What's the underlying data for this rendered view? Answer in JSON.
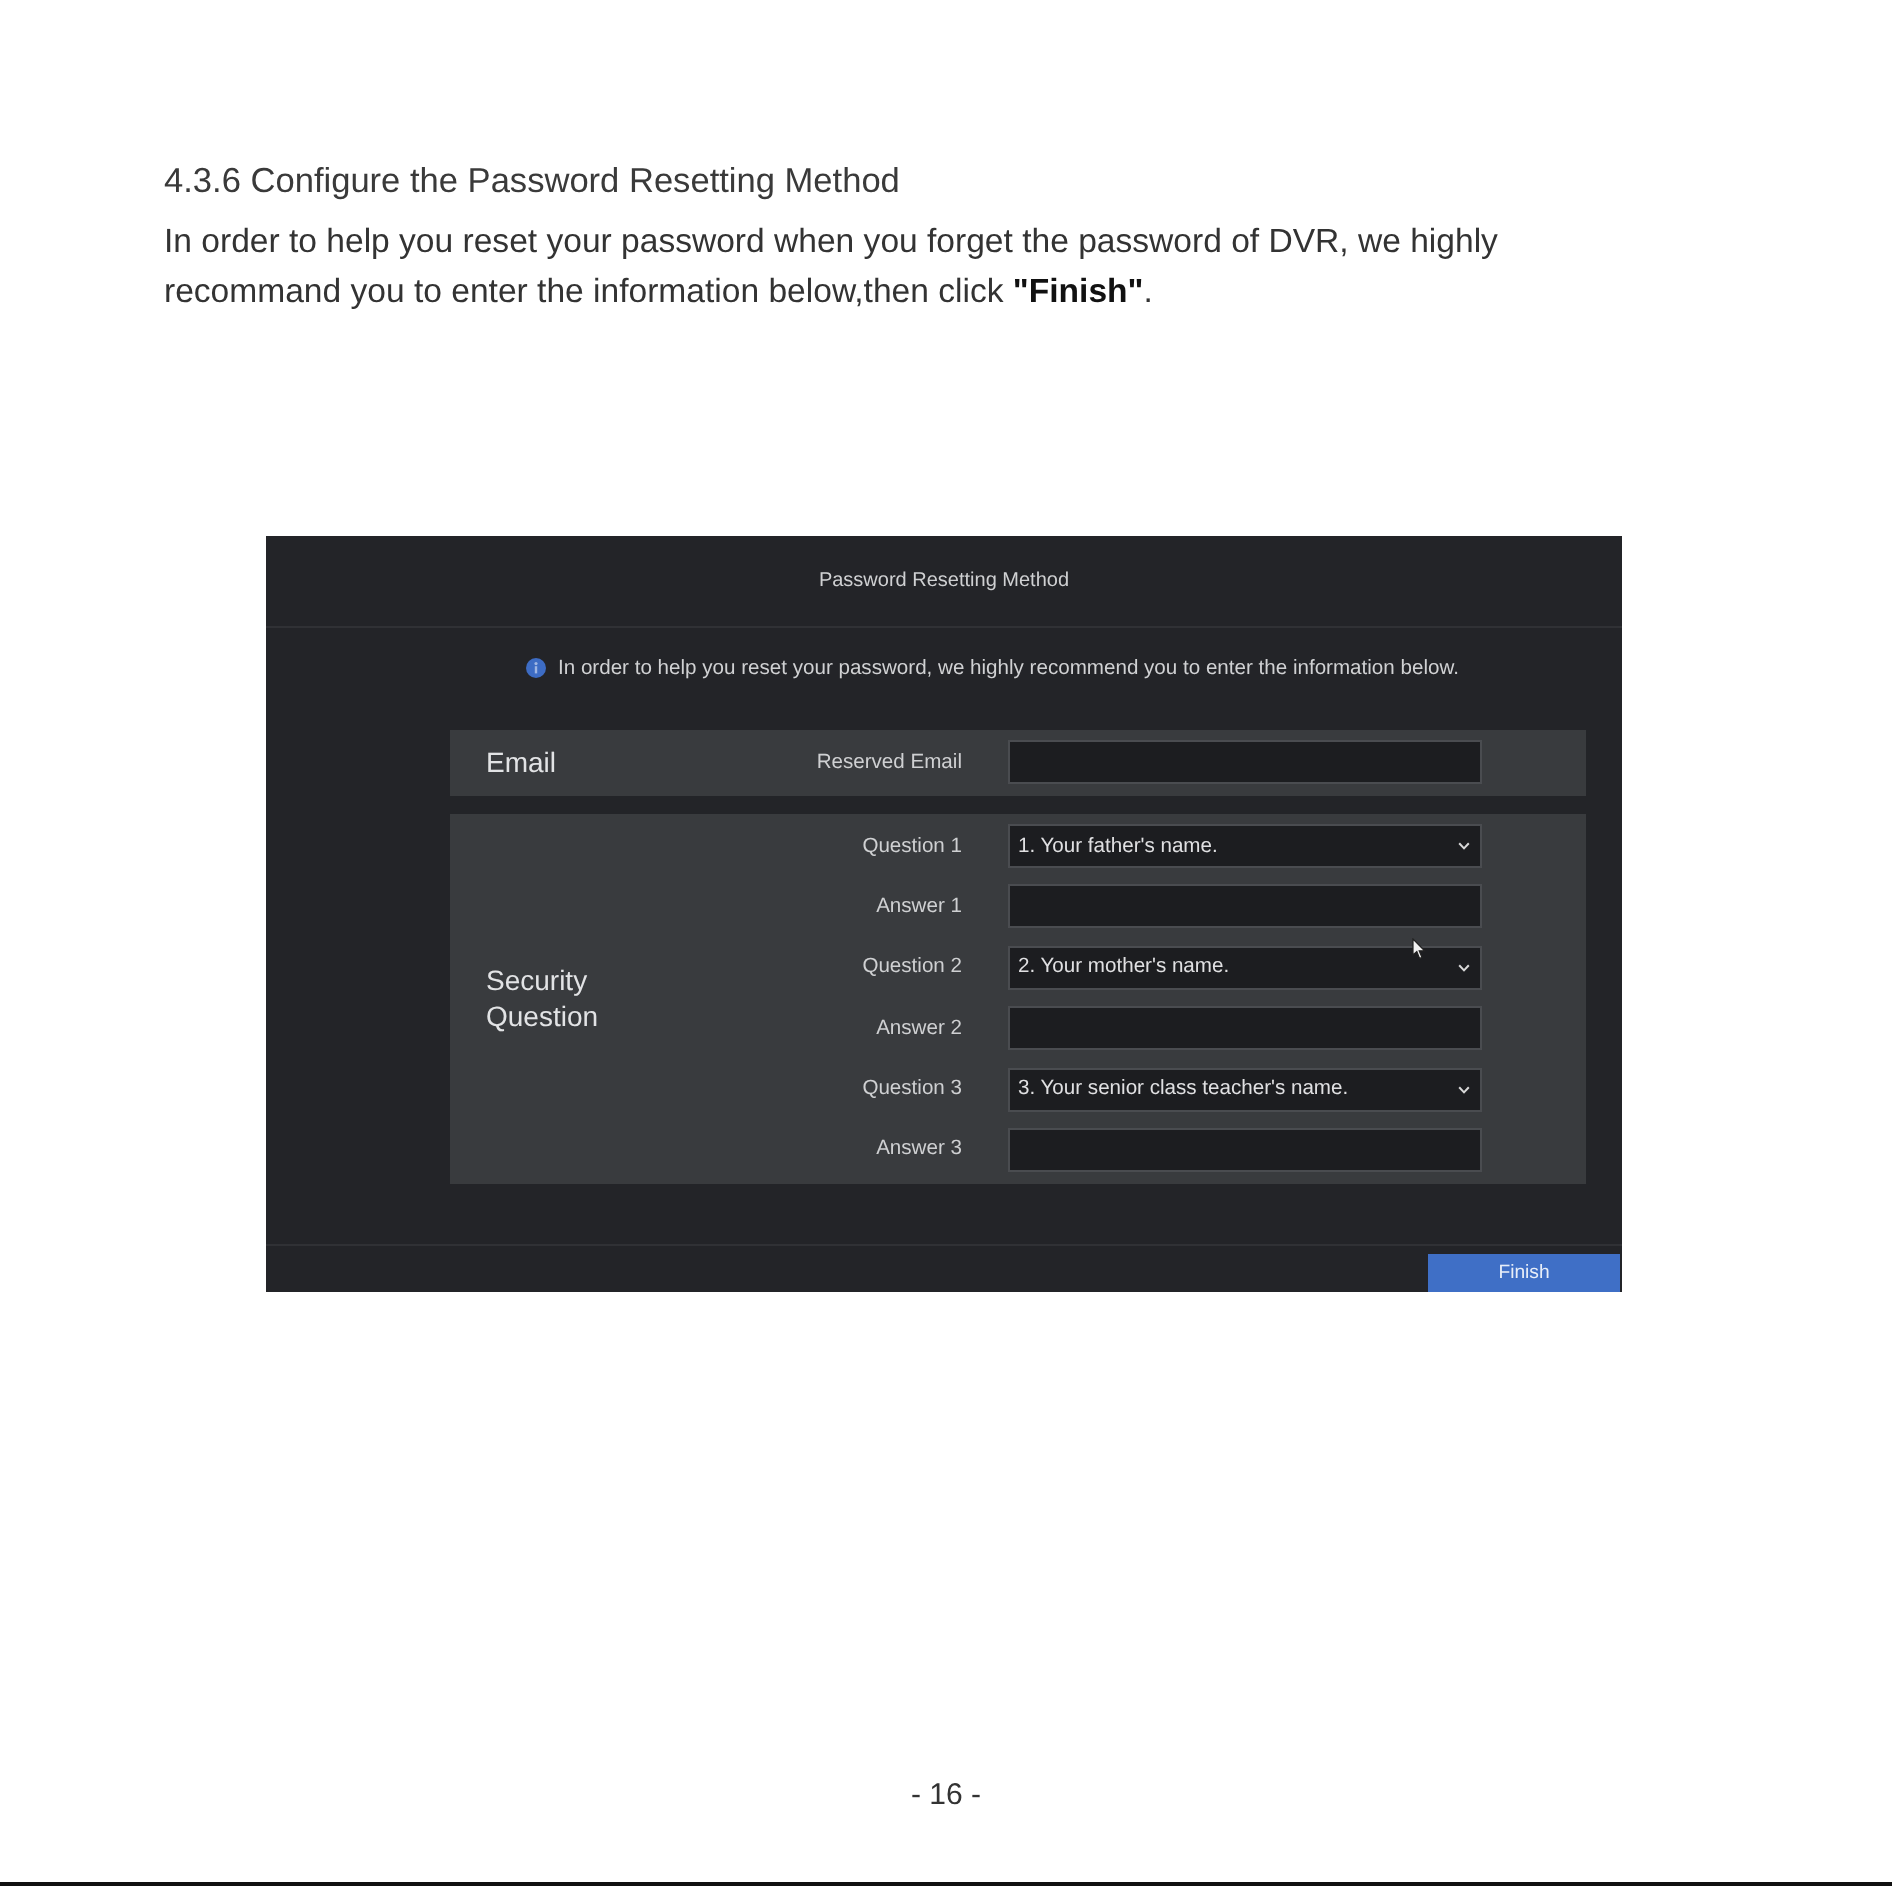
{
  "section_heading": "4.3.6 Configure the Password Resetting Method",
  "intro": "In order to help you reset your password when you forget the password of DVR, we highly recommand you to enter the information below,then click **\"Finish\"**.",
  "dialog": {
    "title": "Password Resetting Method",
    "info": "In order to help you reset your password, we highly recommend you to enter the information below.",
    "sections": [
      {
        "heading": "Email",
        "fields": [
          {
            "label": "Reserved Email",
            "kind": "text"
          }
        ]
      },
      {
        "heading": "Security Question",
        "fields": [
          {
            "label": "Question 1",
            "kind": "dropdown",
            "value": "1. Your father's name."
          },
          {
            "label": "Answer 1",
            "kind": "text"
          },
          {
            "label": "Question 2",
            "kind": "dropdown",
            "value": "2. Your mother's name."
          },
          {
            "label": "Answer 2",
            "kind": "text"
          },
          {
            "label": "Question 3",
            "kind": "dropdown",
            "value": "3. Your senior class teacher's name."
          },
          {
            "label": "Answer 3",
            "kind": "text"
          }
        ]
      }
    ],
    "buttons": [
      {
        "label": "Finish"
      }
    ]
  },
  "page_number": "- 16 -"
}
